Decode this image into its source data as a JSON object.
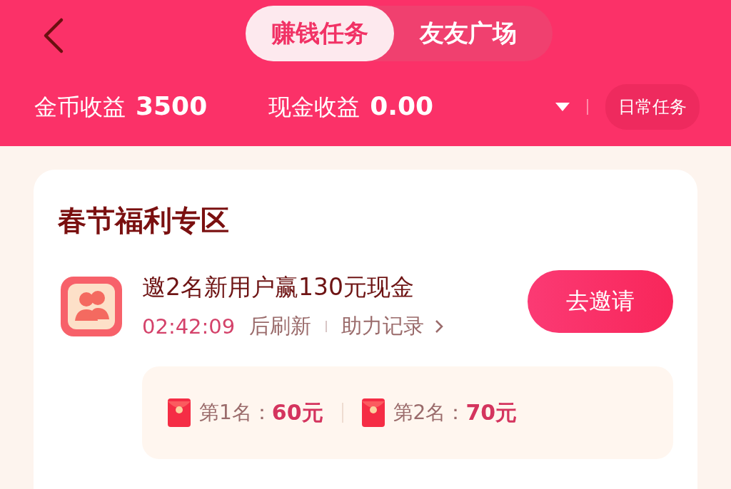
{
  "tabs": [
    {
      "label": "赚钱任务",
      "selected": true
    },
    {
      "label": "友友广场",
      "selected": false
    }
  ],
  "stats": [
    {
      "label": "金币收益",
      "value": "3500"
    },
    {
      "label": "现金收益",
      "value": "0.00"
    }
  ],
  "daily_button": "日常任务",
  "section": {
    "title": "春节福利专区",
    "task": {
      "title": "邀2名新用户赢130元现金",
      "countdown": "02:42:09",
      "countdown_suffix": "后刷新",
      "record_link": "助力记录",
      "button": "去邀请"
    },
    "rewards": [
      {
        "label": "第1名：",
        "amount": "60元"
      },
      {
        "label": "第2名：",
        "amount": "70元"
      }
    ]
  }
}
